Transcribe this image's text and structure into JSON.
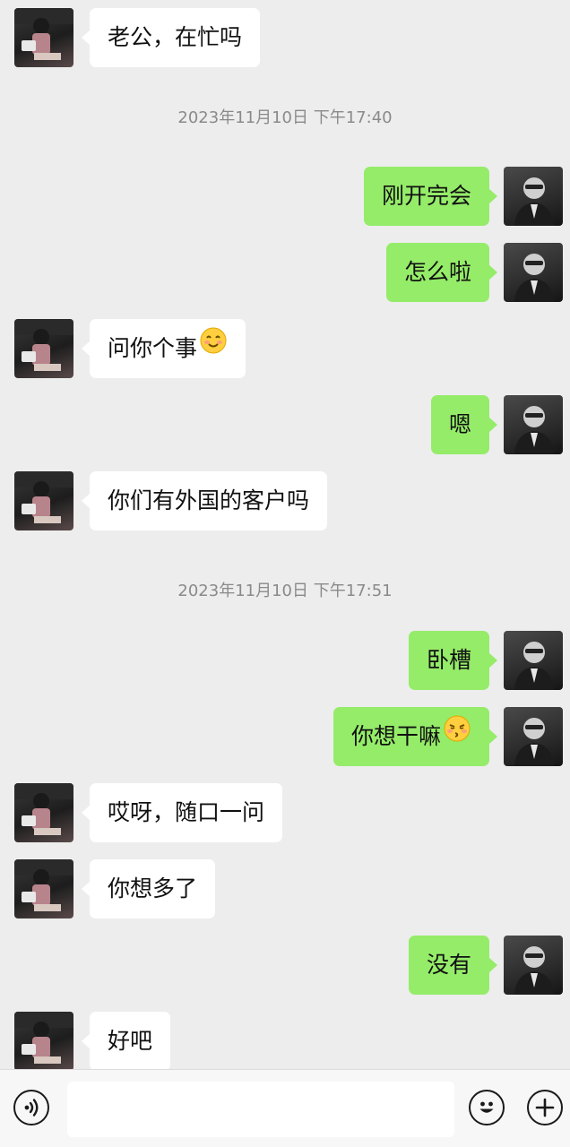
{
  "theme": {
    "background": "#ededed",
    "bubble_self": "#95ec69",
    "bubble_other": "#ffffff",
    "timestamp_color": "#8a8a8a"
  },
  "timestamps": [
    {
      "text": "2023年11月10日 下午17:40"
    },
    {
      "text": "2023年11月10日 下午17:51"
    }
  ],
  "messages": [
    {
      "side": "left",
      "text": "老公，在忙吗"
    },
    {
      "side": "right",
      "text": "刚开完会"
    },
    {
      "side": "right",
      "text": "怎么啦"
    },
    {
      "side": "left",
      "text": "问你个事",
      "emoji": "smiling-face-icon"
    },
    {
      "side": "right",
      "text": "嗯"
    },
    {
      "side": "left",
      "text": "你们有外国的客户吗"
    },
    {
      "side": "right",
      "text": "卧槽"
    },
    {
      "side": "right",
      "text": "你想干嘛",
      "emoji": "kissing-face-icon"
    },
    {
      "side": "left",
      "text": "哎呀，随口一问"
    },
    {
      "side": "left",
      "text": "你想多了"
    },
    {
      "side": "right",
      "text": "没有"
    },
    {
      "side": "left",
      "text": "好吧"
    }
  ],
  "input_bar": {
    "voice_icon": "voice-icon",
    "text_value": "",
    "emoji_icon": "emoji-icon",
    "plus_icon": "plus-icon"
  }
}
